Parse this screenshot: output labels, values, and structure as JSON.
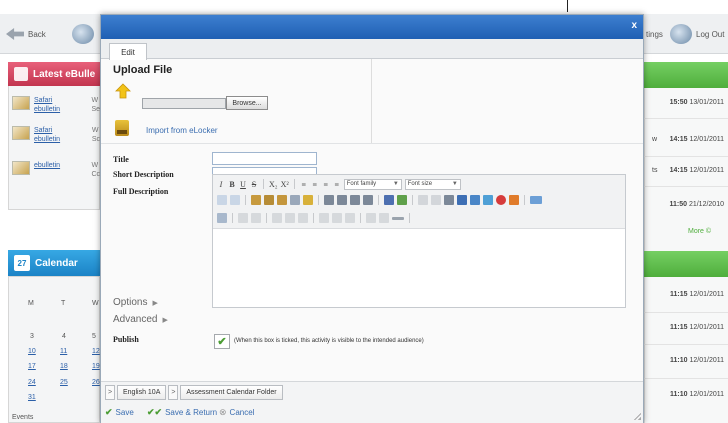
{
  "background": {
    "back_label": "Back",
    "settings_label": "tings",
    "logout_label": "Log Out",
    "bulletin_header": "Latest eBulle",
    "bulletins": [
      {
        "link1": "Safari",
        "link2": "ebulletin",
        "tag1": "W",
        "tag2": "Se"
      },
      {
        "link1": "Safari",
        "link2": "ebulletin",
        "tag1": "W",
        "tag2": "Sc"
      },
      {
        "link1": "ebulletin",
        "link2": "",
        "tag1": "W",
        "tag2": "Cc"
      }
    ],
    "calendar_icon": "27",
    "calendar_header": "Calendar",
    "calendar_days": [
      "M",
      "T",
      "W"
    ],
    "calendar_numbers": [
      [
        "3",
        "4",
        "5"
      ],
      [
        "10",
        "11",
        "12"
      ],
      [
        "17",
        "18",
        "19"
      ],
      [
        "24",
        "25",
        "26"
      ],
      [
        "31",
        "",
        ""
      ]
    ],
    "events_label": "Events",
    "right_col_top": [
      {
        "prefix": "",
        "time": "15:50",
        "date": "13/01/2011"
      },
      {
        "prefix": "w",
        "time": "14:15",
        "date": "12/01/2011"
      },
      {
        "prefix": "ts",
        "time": "14:15",
        "date": "12/01/2011"
      },
      {
        "prefix": "",
        "time": "11:50",
        "date": "21/12/2010"
      }
    ],
    "more_label": "More ©",
    "right_col_bottom": [
      {
        "time": "11:15",
        "date": "12/01/2011"
      },
      {
        "time": "11:15",
        "date": "12/01/2011"
      },
      {
        "time": "11:10",
        "date": "12/01/2011"
      },
      {
        "time": "11:10",
        "date": "12/01/2011"
      }
    ]
  },
  "modal": {
    "close_label": "x",
    "tab_edit": "Edit",
    "upload_title": "Upload File",
    "browse_label": "Browse...",
    "elocker_label": "Import from eLocker",
    "labels": {
      "title": "Title",
      "short_description": "Short Description",
      "full_description": "Full Description",
      "publish": "Publish"
    },
    "toolbar": {
      "row1": [
        "I",
        "B",
        "U",
        "S",
        "X₂",
        "X²",
        "≡",
        "≡",
        "≡",
        "≡"
      ],
      "font_family": "Font family",
      "font_size": "Font size"
    },
    "options_label": "Options",
    "advanced_label": "Advanced",
    "toggle_arrow": "▶",
    "publish_checked": true,
    "publish_note": "(When this box is ticked, this activity is visible to the intended audience)",
    "breadcrumb": [
      "English 10A",
      "Assessment Calendar Folder"
    ],
    "breadcrumb_sep": ">",
    "actions": {
      "save": "Save",
      "save_return": "Save & Return",
      "cancel": "Cancel"
    },
    "colors": {
      "titlebar": "#1f5fb3",
      "save_icon": "#4b9d34",
      "link": "#3a6db0"
    }
  }
}
